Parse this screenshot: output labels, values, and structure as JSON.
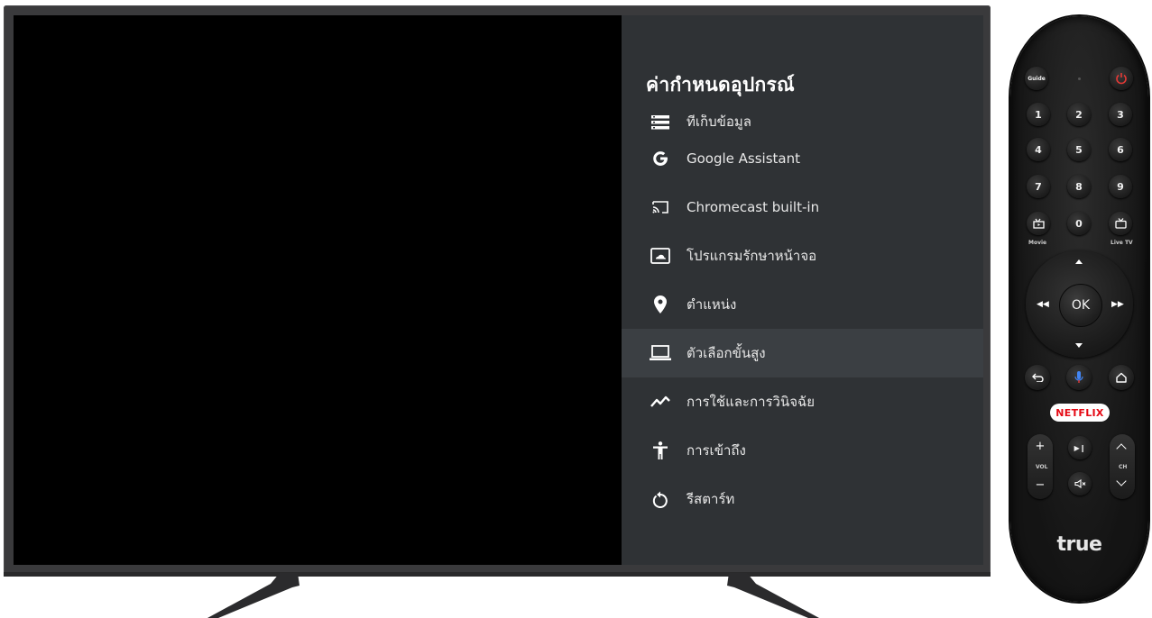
{
  "settings": {
    "title": "ค่ากำหนดอุปกรณ์",
    "items": [
      {
        "label": "ที่เก็บข้อมูล",
        "icon": "storage-icon"
      },
      {
        "label": "Google Assistant",
        "icon": "google-icon"
      },
      {
        "label": "Chromecast built-in",
        "icon": "cast-icon"
      },
      {
        "label": "โปรแกรมรักษาหน้าจอ",
        "icon": "screensaver-icon"
      },
      {
        "label": "ตำแหน่ง",
        "icon": "location-pin-icon"
      },
      {
        "label": "ตัวเลือกขั้นสูง",
        "icon": "laptop-icon",
        "selected": true
      },
      {
        "label": "การใช้และการวินิจฉัย",
        "icon": "activity-graph-icon"
      },
      {
        "label": "การเข้าถึง",
        "icon": "accessibility-icon"
      },
      {
        "label": "รีสตาร์ท",
        "icon": "restart-icon"
      }
    ]
  },
  "remote": {
    "guide_label": "Guide",
    "numbers": [
      "1",
      "2",
      "3",
      "4",
      "5",
      "6",
      "7",
      "8",
      "9",
      "0"
    ],
    "movie_label": "Movie",
    "live_tv_label": "Live TV",
    "ok_label": "OK",
    "netflix_label": "NETFLIX",
    "vol_label": "VOL",
    "ch_label": "CH",
    "brand": "true",
    "colors": {
      "power": "#e53935",
      "netflix": "#e50914",
      "mic": "#4285f4"
    }
  }
}
